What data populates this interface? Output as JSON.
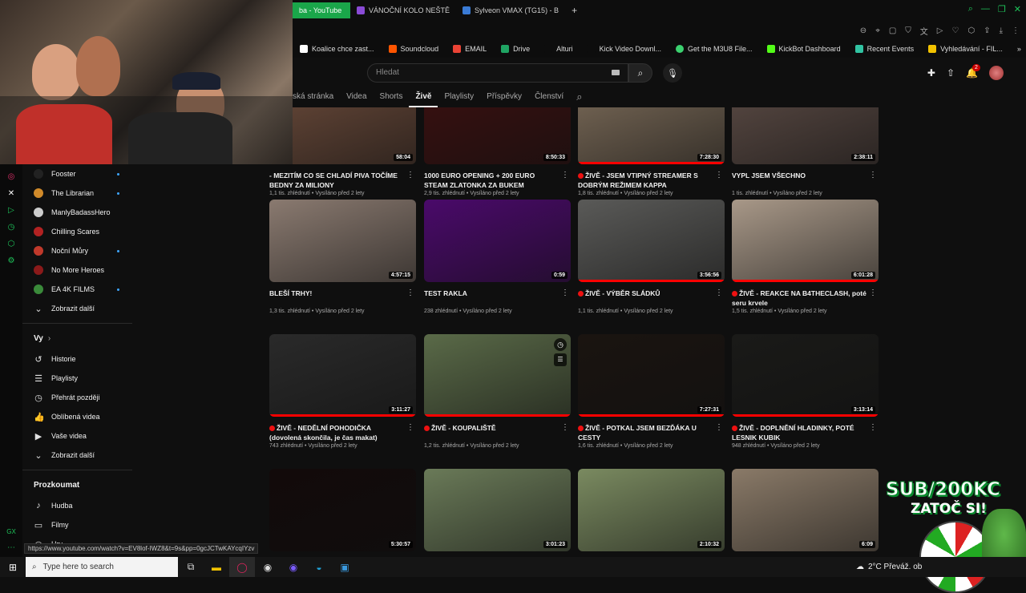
{
  "tabs": [
    {
      "label": "ba - YouTube",
      "color": "#1aa64a",
      "active": true
    },
    {
      "label": "VÁNOČNÍ KOLO NEŠTĚ",
      "color": "#8a4bd6"
    },
    {
      "label": "Sylveon VMAX (TG15) - B",
      "color": "#3a7bd5"
    }
  ],
  "bookmarks": [
    {
      "label": "Koalice chce zast...",
      "color": "#ffffff"
    },
    {
      "label": "Soundcloud",
      "color": "#ff5500"
    },
    {
      "label": "EMAIL",
      "color": "#ea4335"
    },
    {
      "label": "Drive",
      "color": "#1fa463"
    },
    {
      "label": "Alturi",
      "color": "#777777"
    },
    {
      "label": "Kick Video Downl...",
      "color": "#444444"
    },
    {
      "label": "Get the M3U8 File...",
      "color": "#3bd16f"
    },
    {
      "label": "KickBot Dashboard",
      "color": "#53fc18"
    },
    {
      "label": "Recent Events",
      "color": "#31c3a2"
    },
    {
      "label": "Vyhledávání - FIL...",
      "color": "#f2c200"
    }
  ],
  "search": {
    "placeholder": "Hledat"
  },
  "notifications": {
    "count": "2"
  },
  "channel_tabs": [
    {
      "label": "ská stránka"
    },
    {
      "label": "Videa"
    },
    {
      "label": "Shorts"
    },
    {
      "label": "Živě",
      "active": true
    },
    {
      "label": "Playlisty"
    },
    {
      "label": "Příspěvky"
    },
    {
      "label": "Členství"
    }
  ],
  "subscriptions": [
    {
      "name": "Fooster",
      "color": "#222222",
      "dot": true
    },
    {
      "name": "The Librarian",
      "color": "#d08a2a",
      "dot": true
    },
    {
      "name": "ManlyBadassHero",
      "color": "#cccccc",
      "dot": false
    },
    {
      "name": "Chilling Scares",
      "color": "#b22222",
      "dot": false
    },
    {
      "name": "Noční Můry",
      "color": "#c0392b",
      "dot": true
    },
    {
      "name": "No More Heroes",
      "color": "#8b1a1a",
      "dot": false
    },
    {
      "name": "EA 4K FILMS",
      "color": "#3a8a3a",
      "dot": true
    },
    {
      "name": "Zobrazit další",
      "icon": "chevron-down-icon",
      "glyph": "⌄"
    }
  ],
  "you_section": {
    "heading": "Vy",
    "items": [
      {
        "label": "Historie",
        "icon": "history-icon",
        "glyph": "↺"
      },
      {
        "label": "Playlisty",
        "icon": "playlist-icon",
        "glyph": "☰"
      },
      {
        "label": "Přehrát později",
        "icon": "clock-icon",
        "glyph": "◷"
      },
      {
        "label": "Oblíbená videa",
        "icon": "thumbs-up-icon",
        "glyph": "👍"
      },
      {
        "label": "Vaše videa",
        "icon": "video-icon",
        "glyph": "▶"
      },
      {
        "label": "Zobrazit další",
        "icon": "chevron-down-icon",
        "glyph": "⌄"
      }
    ]
  },
  "explore_section": {
    "heading": "Prozkoumat",
    "items": [
      {
        "label": "Hudba",
        "icon": "music-icon",
        "glyph": "♪"
      },
      {
        "label": "Filmy",
        "icon": "film-icon",
        "glyph": "▭"
      },
      {
        "label": "Hry",
        "icon": "gamepad-icon",
        "glyph": "◎"
      }
    ]
  },
  "videos": [
    {
      "title": "- MEZITÍM CO SE CHLADÍ PIVA TOČÍME BEDNY ZA MILIONY",
      "live": false,
      "duration": "58:04",
      "views": "1,1 tis. zhlédnutí",
      "age": "Vysíláno před 2 lety",
      "thumb": "#6a4a3a"
    },
    {
      "title": "1000 EURO OPENING + 200 EURO STEAM ZLATONKA ZA BUKEM",
      "live": false,
      "duration": "8:50:33",
      "views": "2,9 tis. zhlédnutí",
      "age": "Vysíláno před 2 lety",
      "thumb": "#3a1010"
    },
    {
      "title": "ŽIVĚ - JSEM VTIPNÝ STREAMER S DOBRÝM REŽIMEM KAPPA",
      "live": true,
      "duration": "7:28:30",
      "views": "1,8 tis. zhlédnutí",
      "age": "Vysíláno před 2 lety",
      "thumb": "#7a6a58"
    },
    {
      "title": "VYPL JSEM VŠECHNO",
      "live": false,
      "duration": "2:38:11",
      "views": "1 tis. zhlédnutí",
      "age": "Vysíláno před 2 lety",
      "thumb": "#5a4a44"
    },
    {
      "title": "BLEŠÍ TRHY!",
      "live": false,
      "duration": "4:57:15",
      "views": "1,3 tis. zhlédnutí",
      "age": "Vysíláno před 2 lety",
      "thumb": "#8a7a70"
    },
    {
      "title": "TEST RAKLA",
      "live": false,
      "duration": "0:59",
      "views": "238 zhlédnutí",
      "age": "Vysíláno před 2 lety",
      "thumb": "#4a0a6a"
    },
    {
      "title": "ŽIVĚ - VÝBĚR SLÁDKŮ",
      "live": true,
      "duration": "3:56:56",
      "views": "1,1 tis. zhlédnutí",
      "age": "Vysíláno před 2 lety",
      "thumb": "#5a5a58"
    },
    {
      "title": "ŽIVĚ - REAKCE NA B4THECLASH, poté seru krvele",
      "live": true,
      "duration": "6:01:28",
      "views": "1,5 tis. zhlédnutí",
      "age": "Vysíláno před 2 lety",
      "thumb": "#a89888"
    },
    {
      "title": "ŽIVĚ - NEDĚLNÍ POHODIČKA (dovolená skončila, je čas makat)",
      "live": true,
      "duration": "3:11:27",
      "views": "743 zhlédnutí",
      "age": "Vysíláno před 2 lety",
      "thumb": "#2a2a2a"
    },
    {
      "title": "ŽIVĚ - KOUPALIŠTĚ",
      "live": true,
      "duration": "",
      "views": "1,2 tis. zhlédnutí",
      "age": "Vysíláno před 2 lety",
      "thumb": "#5a6a48"
    },
    {
      "title": "ŽIVĚ - POTKAL JSEM BEZĎÁKA U CESTY",
      "live": true,
      "duration": "7:27:31",
      "views": "1,6 tis. zhlédnutí",
      "age": "Vysíláno před 2 lety",
      "thumb": "#1a1410"
    },
    {
      "title": "ŽIVĚ - DOPLNĚNÍ HLADINKY, POTÉ LESNIK KUBIK",
      "live": true,
      "duration": "3:13:14",
      "views": "948 zhlédnutí",
      "age": "Vysíláno před 2 lety",
      "thumb": "#1a1a18"
    },
    {
      "title": "",
      "live": false,
      "duration": "5:30:57",
      "views": "",
      "age": "",
      "thumb": "#120a0a"
    },
    {
      "title": "",
      "live": false,
      "duration": "3:01:23",
      "views": "",
      "age": "",
      "thumb": "#6a7a58"
    },
    {
      "title": "",
      "live": false,
      "duration": "2:10:32",
      "views": "",
      "age": "",
      "thumb": "#7a8a60"
    },
    {
      "title": "",
      "live": false,
      "duration": "6:09",
      "views": "",
      "age": "",
      "thumb": "#8a7a68"
    }
  ],
  "status_url": "https://www.youtube.com/watch?v=EV8lof-IWZ8&t=9s&pp=0gcJCTwKAYcqIYzv",
  "stream_overlay": {
    "line1": "SUB/200KC",
    "line2": "ZATOČ SI!"
  },
  "taskbar": {
    "search_placeholder": "Type here to search",
    "weather": "2°C  Převáž. ob"
  }
}
